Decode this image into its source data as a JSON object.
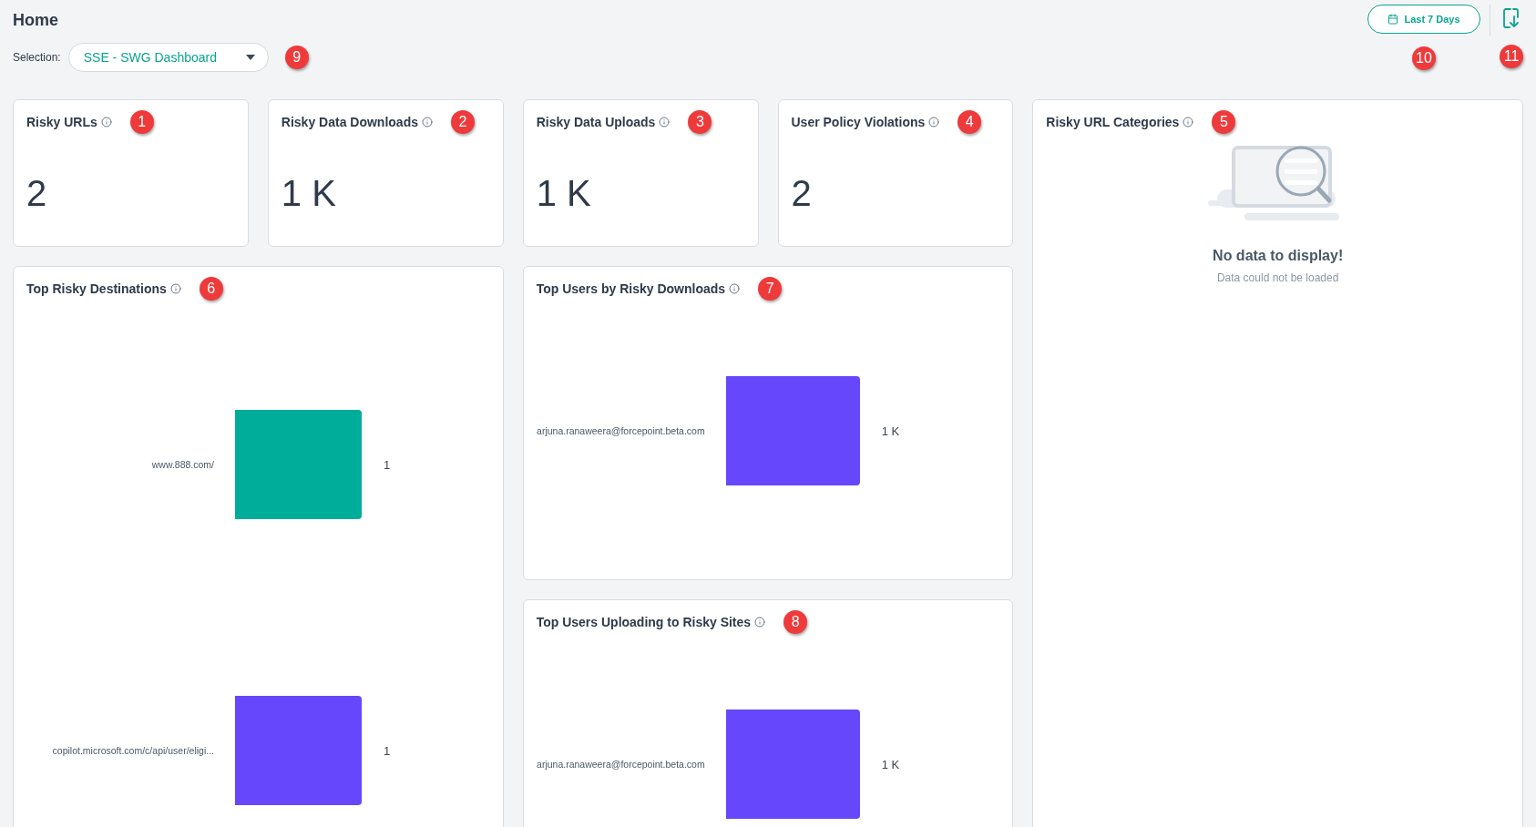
{
  "page": {
    "title": "Home"
  },
  "selection": {
    "label": "Selection:",
    "value": "SSE - SWG Dashboard",
    "callout": "9"
  },
  "toolbar": {
    "date_range": {
      "label": "Last 7 Days",
      "callout": "10"
    },
    "download": {
      "callout": "11"
    }
  },
  "stat_cards": [
    {
      "title": "Risky URLs",
      "value": "2",
      "callout": "1"
    },
    {
      "title": "Risky Data Downloads",
      "value": "1 K",
      "callout": "2"
    },
    {
      "title": "Risky Data Uploads",
      "value": "1 K",
      "callout": "3"
    },
    {
      "title": "User Policy Violations",
      "value": "2",
      "callout": "4"
    }
  ],
  "categories_panel": {
    "title": "Risky URL Categories",
    "callout": "5",
    "empty_state": {
      "heading": "No data to display!",
      "message": "Data could not be loaded"
    }
  },
  "charts": [
    {
      "title": "Top Risky Destinations",
      "callout": "6",
      "chart_data": {
        "type": "bar",
        "orientation": "horizontal",
        "categories": [
          "www.888.com/",
          "copilot.microsoft.com/c/api/user/eligi..."
        ],
        "values": [
          1,
          1
        ],
        "value_labels": [
          "1",
          "1"
        ],
        "colors": [
          "#00ad9a",
          "#6747fc"
        ]
      }
    },
    {
      "title": "Top Users by Risky Downloads",
      "callout": "7",
      "bars": [
        {
          "label": "arjuna.ranaweera@forcepoint.beta.com",
          "value": "1 K",
          "color": "#6747fc"
        }
      ]
    },
    {
      "title": "Top Users Uploading to Risky Sites",
      "callout": "8",
      "bars": [
        {
          "label": "arjuna.ranaweera@forcepoint.beta.com",
          "value": "1 K",
          "color": "#6747fc"
        }
      ]
    }
  ]
}
